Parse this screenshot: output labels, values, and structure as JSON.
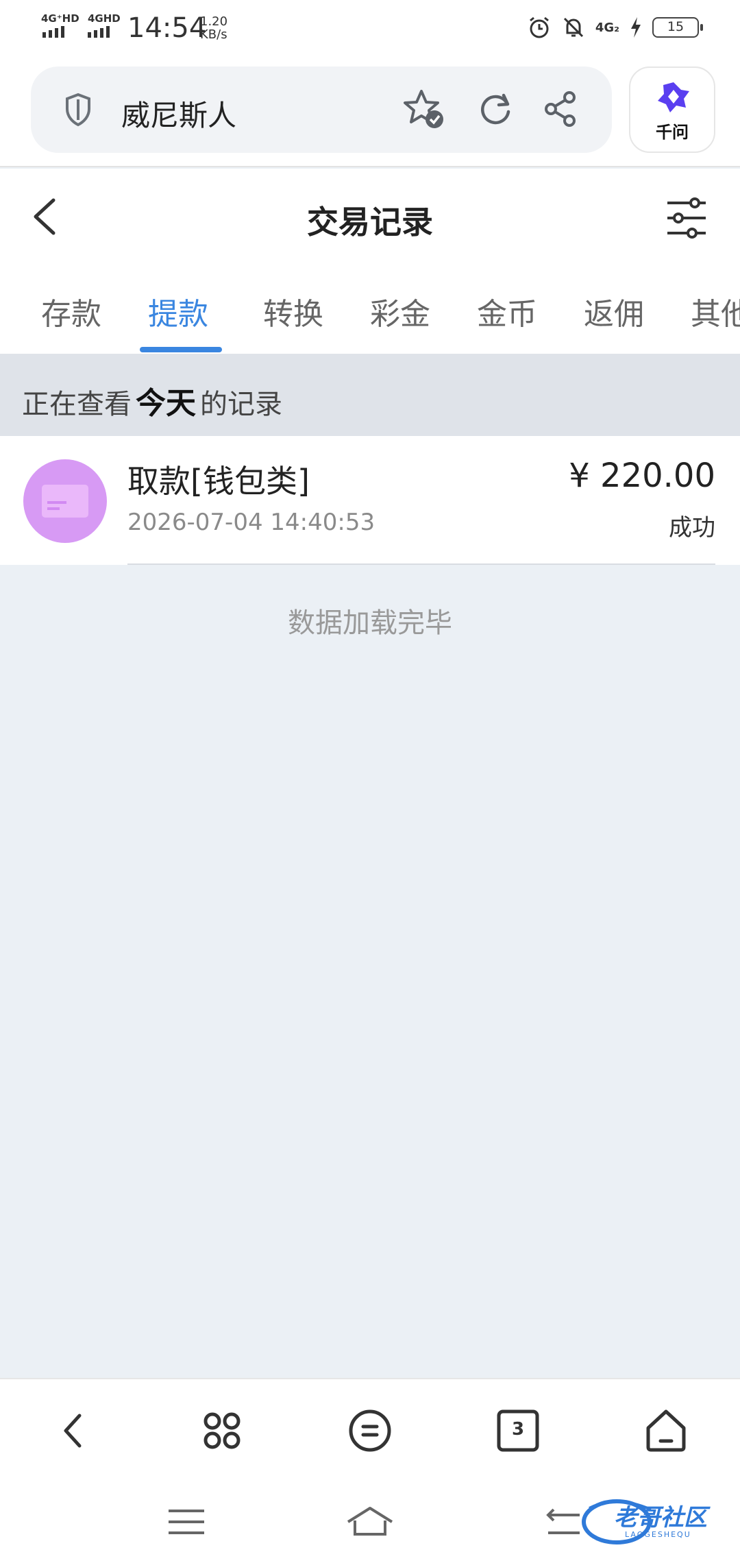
{
  "status_bar": {
    "network1": "4G⁺HD",
    "network2": "4GHD",
    "time": "14:54",
    "speed_value": "1.20",
    "speed_unit": "KB/s",
    "network3": "4G₂",
    "battery": "15"
  },
  "browser": {
    "url": "威尼斯人",
    "ai_label": "千问"
  },
  "page": {
    "title": "交易记录"
  },
  "tabs": [
    {
      "label": "存款",
      "active": false
    },
    {
      "label": "提款",
      "active": true
    },
    {
      "label": "转换",
      "active": false
    },
    {
      "label": "彩金",
      "active": false
    },
    {
      "label": "金币",
      "active": false
    },
    {
      "label": "返佣",
      "active": false
    },
    {
      "label": "其他",
      "active": false
    }
  ],
  "filter": {
    "prefix": "正在查看",
    "period": "今天",
    "suffix": "的记录"
  },
  "records": [
    {
      "title": "取款[钱包类]",
      "time": "2026-07-04 14:40:53",
      "amount": "¥ 220.00",
      "status": "成功",
      "icon": "card-icon",
      "icon_color": "#d79af4"
    }
  ],
  "load_complete": "数据加载完毕",
  "bottom_nav": {
    "tab_count": "3"
  },
  "watermark": {
    "text": "老哥社区",
    "sub": "LAOGESHEQU"
  },
  "colors": {
    "accent": "#3a86e0",
    "background": "#ebf0f5"
  }
}
